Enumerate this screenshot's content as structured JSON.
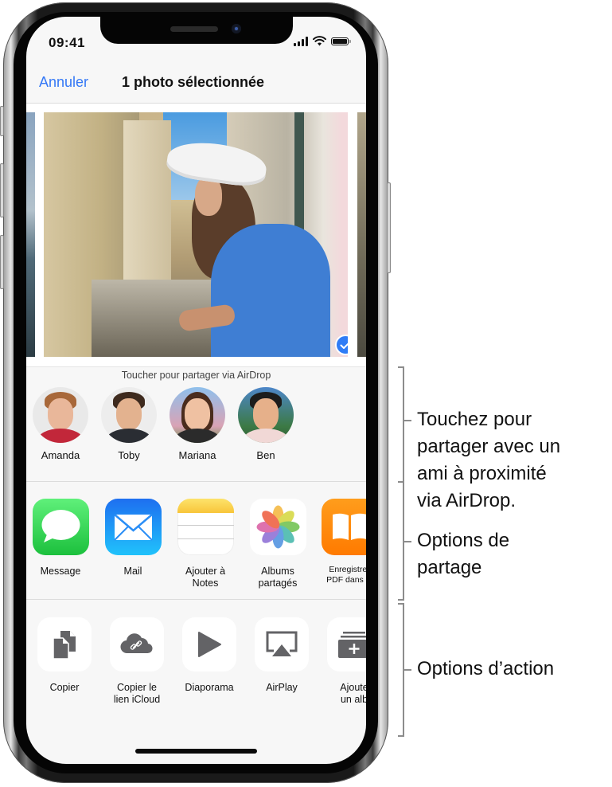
{
  "status_bar": {
    "time": "09:41",
    "icons": [
      "cellular-signal-icon",
      "wifi-icon",
      "battery-icon"
    ]
  },
  "nav": {
    "cancel_label": "Annuler",
    "title": "1 photo sélectionnée"
  },
  "photos": {
    "selected_count": 1,
    "main_photo_selected": true,
    "check_icon": "checkmark-circle-icon"
  },
  "airdrop": {
    "hint": "Toucher pour partager via AirDrop",
    "people": [
      {
        "name": "Amanda"
      },
      {
        "name": "Toby"
      },
      {
        "name": "Mariana"
      },
      {
        "name": "Ben"
      }
    ]
  },
  "share_apps": [
    {
      "label": "Message",
      "icon": "messages-icon",
      "color": "#34c759"
    },
    {
      "label": "Mail",
      "icon": "mail-icon",
      "color": "#1a8cff"
    },
    {
      "label": "Ajouter à\nNotes",
      "line1": "Ajouter à",
      "line2": "Notes",
      "icon": "notes-icon",
      "color": "#fcd34d"
    },
    {
      "label": "Albums\npartagés",
      "line1": "Albums",
      "line2": "partagés",
      "icon": "photos-icon",
      "color": "#ffffff"
    },
    {
      "label": "Enregistrer\nPDF dans Li",
      "line1": "Enregistrer",
      "line2": "PDF dans Li",
      "icon": "books-icon",
      "color": "#ff8a00"
    }
  ],
  "actions": [
    {
      "label": "Copier",
      "icon": "copy-icon"
    },
    {
      "label": "Copier le\nlien iCloud",
      "line1": "Copier le",
      "line2": "lien iCloud",
      "icon": "icloud-link-icon"
    },
    {
      "label": "Diaporama",
      "icon": "play-icon"
    },
    {
      "label": "AirPlay",
      "icon": "airplay-icon"
    },
    {
      "label": "Ajoute\nun alb",
      "line1": "Ajoute",
      "line2": "un alb",
      "icon": "add-album-icon"
    }
  ],
  "callouts": {
    "airdrop": [
      "Touchez pour",
      "partager avec un",
      "ami à proximité",
      "via AirDrop."
    ],
    "share": [
      "Options de",
      "partage"
    ],
    "action": [
      "Options d’action"
    ]
  },
  "colors": {
    "accent": "#3478f6",
    "icon_gray": "#636366"
  }
}
